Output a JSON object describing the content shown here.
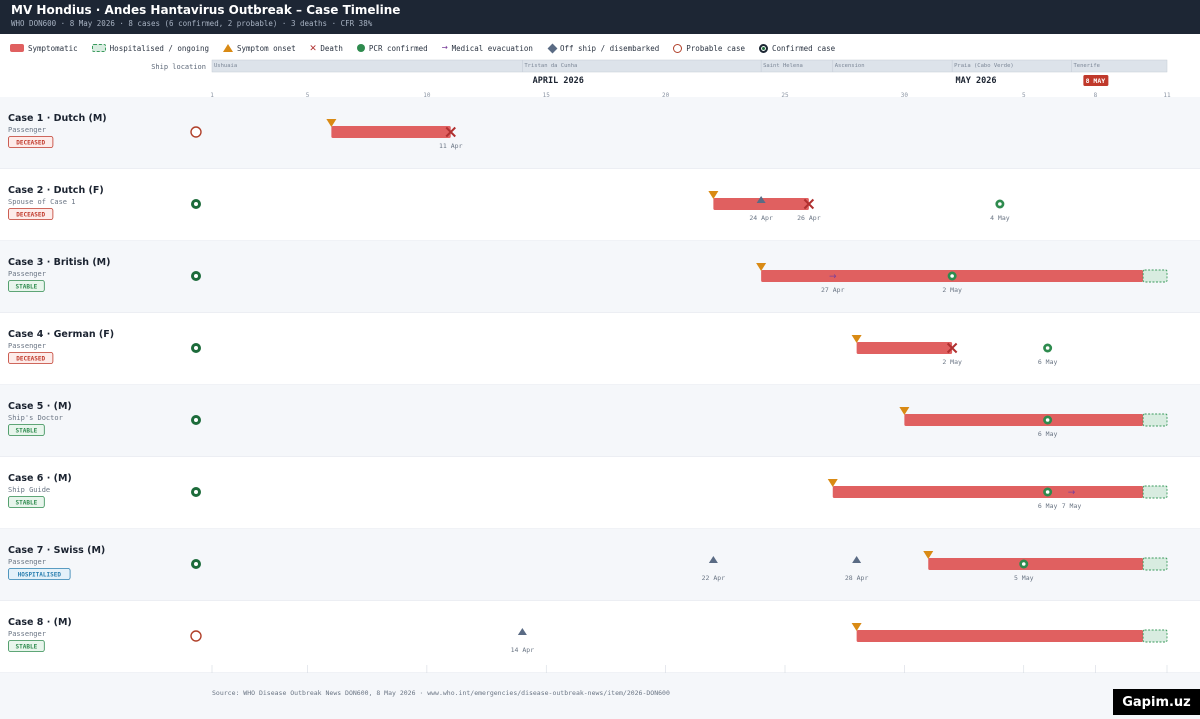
{
  "header": {
    "title": "MV Hondius · Andes Hantavirus Outbreak – Case Timeline",
    "subtitle": "WHO DON600 · 8 May 2026 · 8 cases (6 confirmed, 2 probable) · 3 deaths · CFR 38%"
  },
  "legend": {
    "items": [
      {
        "key": "symptomatic",
        "label": "Symptomatic",
        "icon": "bar-swatch"
      },
      {
        "key": "hospitalised",
        "label": "Hospitalised / ongoing",
        "icon": "dashed-bar-swatch"
      },
      {
        "key": "onset",
        "label": "Symptom onset",
        "icon": "triangle-icon"
      },
      {
        "key": "death",
        "label": "Death",
        "icon": "x-mark-icon"
      },
      {
        "key": "pcr",
        "label": "PCR confirmed",
        "icon": "dot-icon"
      },
      {
        "key": "medevac",
        "label": "Medical evacuation",
        "icon": "arrow-right-icon"
      },
      {
        "key": "offship",
        "label": "Off ship / disembarked",
        "icon": "diamond-icon"
      },
      {
        "key": "probable",
        "label": "Probable case",
        "icon": "hollow-circle-icon"
      },
      {
        "key": "confirmed",
        "label": "Confirmed case",
        "icon": "ringed-dot-icon"
      }
    ]
  },
  "colors": {
    "symptomatic": "#e06060",
    "hospital_fill": "#d8ece0",
    "hospital_border": "#3a9a5c",
    "onset": "#d98a14",
    "death": "#b03030",
    "pcr": "#2e8b4e",
    "medevac": "#7a3f9a",
    "offship": "#5a6b84",
    "probable": "#b0402a",
    "confirmed": "#1c6b3a",
    "today": "#c0392b",
    "deceased": "#c0392b",
    "stable": "#2e8b4e",
    "hospitalised_badge": "#2a7fb0"
  },
  "chart_data": {
    "type": "timeline",
    "ship_location_label": "Ship location",
    "x_range": [
      "2026-04-01",
      "2026-05-11"
    ],
    "months": [
      {
        "label": "APRIL 2026",
        "date": "2026-04-15"
      },
      {
        "label": "MAY 2026",
        "date": "2026-05-03"
      }
    ],
    "ticks": [
      {
        "label": "1",
        "date": "2026-04-01"
      },
      {
        "label": "5",
        "date": "2026-04-05"
      },
      {
        "label": "10",
        "date": "2026-04-10"
      },
      {
        "label": "15",
        "date": "2026-04-15"
      },
      {
        "label": "20",
        "date": "2026-04-20"
      },
      {
        "label": "25",
        "date": "2026-04-25"
      },
      {
        "label": "30",
        "date": "2026-04-30"
      },
      {
        "label": "5",
        "date": "2026-05-05"
      },
      {
        "label": "8",
        "date": "2026-05-08"
      },
      {
        "label": "11",
        "date": "2026-05-11"
      }
    ],
    "today": {
      "label": "8 MAY",
      "date": "2026-05-08"
    },
    "locations": [
      {
        "label": "Ushuaia",
        "start": "2026-04-01",
        "end": "2026-04-14"
      },
      {
        "label": "Tristan da Cunha",
        "start": "2026-04-14",
        "end": "2026-04-24"
      },
      {
        "label": "Saint Helena",
        "start": "2026-04-24",
        "end": "2026-04-27"
      },
      {
        "label": "Ascension",
        "start": "2026-04-27",
        "end": "2026-05-02"
      },
      {
        "label": "Praia (Cabo Verde)",
        "start": "2026-05-02",
        "end": "2026-05-07"
      },
      {
        "label": "Tenerife",
        "start": "2026-05-07",
        "end": "2026-05-11"
      }
    ],
    "cases": [
      {
        "title": "Case 1 · Dutch (M)",
        "role": "Passenger",
        "status": "DECEASED",
        "classification": "probable",
        "bars": [
          {
            "start": "2026-04-06",
            "end": "2026-04-11"
          }
        ],
        "hospital": null,
        "events": [
          {
            "type": "onset",
            "date": "2026-04-06"
          },
          {
            "type": "death",
            "date": "2026-04-11",
            "label": "11 Apr"
          }
        ]
      },
      {
        "title": "Case 2 · Dutch (F)",
        "role": "Spouse of Case 1",
        "status": "DECEASED",
        "classification": "confirmed",
        "bars": [
          {
            "start": "2026-04-22",
            "end": "2026-04-26"
          }
        ],
        "hospital": null,
        "events": [
          {
            "type": "onset",
            "date": "2026-04-22"
          },
          {
            "type": "offship",
            "date": "2026-04-24",
            "label": "24 Apr"
          },
          {
            "type": "death",
            "date": "2026-04-26",
            "label": "26 Apr"
          },
          {
            "type": "pcr",
            "date": "2026-05-04",
            "label": "4 May"
          }
        ]
      },
      {
        "title": "Case 3 · British (M)",
        "role": "Passenger",
        "status": "STABLE",
        "classification": "confirmed",
        "bars": [
          {
            "start": "2026-04-24",
            "end": "2026-05-10"
          }
        ],
        "hospital": {
          "start": "2026-05-10",
          "end": "2026-05-11"
        },
        "events": [
          {
            "type": "onset",
            "date": "2026-04-24"
          },
          {
            "type": "medevac",
            "date": "2026-04-27",
            "label": "27 Apr"
          },
          {
            "type": "pcr",
            "date": "2026-05-02",
            "label": "2 May"
          }
        ]
      },
      {
        "title": "Case 4 · German (F)",
        "role": "Passenger",
        "status": "DECEASED",
        "classification": "confirmed",
        "bars": [
          {
            "start": "2026-04-28",
            "end": "2026-05-02"
          }
        ],
        "hospital": null,
        "events": [
          {
            "type": "onset",
            "date": "2026-04-28"
          },
          {
            "type": "death",
            "date": "2026-05-02",
            "label": "2 May"
          },
          {
            "type": "pcr",
            "date": "2026-05-06",
            "label": "6 May"
          }
        ]
      },
      {
        "title": "Case 5 · (M)",
        "role": "Ship's Doctor",
        "status": "STABLE",
        "classification": "confirmed",
        "bars": [
          {
            "start": "2026-04-30",
            "end": "2026-05-10"
          }
        ],
        "hospital": {
          "start": "2026-05-10",
          "end": "2026-05-11"
        },
        "events": [
          {
            "type": "onset",
            "date": "2026-04-30"
          },
          {
            "type": "medevac",
            "date": "2026-05-06"
          },
          {
            "type": "pcr",
            "date": "2026-05-06",
            "label": "6 May"
          }
        ]
      },
      {
        "title": "Case 6 · (M)",
        "role": "Ship Guide",
        "status": "STABLE",
        "classification": "confirmed",
        "bars": [
          {
            "start": "2026-04-27",
            "end": "2026-05-10"
          }
        ],
        "hospital": {
          "start": "2026-05-10",
          "end": "2026-05-11"
        },
        "events": [
          {
            "type": "onset",
            "date": "2026-04-27"
          },
          {
            "type": "pcr",
            "date": "2026-05-06",
            "label": "6 May"
          },
          {
            "type": "medevac",
            "date": "2026-05-07",
            "label": "7 May"
          }
        ]
      },
      {
        "title": "Case 7 · Swiss (M)",
        "role": "Passenger",
        "status": "HOSPITALISED",
        "classification": "confirmed",
        "bars": [
          {
            "start": "2026-05-01",
            "end": "2026-05-10"
          }
        ],
        "hospital": {
          "start": "2026-05-10",
          "end": "2026-05-11"
        },
        "events": [
          {
            "type": "offship",
            "date": "2026-04-22",
            "label": "22 Apr"
          },
          {
            "type": "offship",
            "date": "2026-04-28",
            "label": "28 Apr"
          },
          {
            "type": "onset",
            "date": "2026-05-01"
          },
          {
            "type": "pcr",
            "date": "2026-05-05",
            "label": "5 May"
          }
        ]
      },
      {
        "title": "Case 8 · (M)",
        "role": "Passenger",
        "status": "STABLE",
        "classification": "probable",
        "bars": [
          {
            "start": "2026-04-28",
            "end": "2026-05-10"
          }
        ],
        "hospital": {
          "start": "2026-05-10",
          "end": "2026-05-11"
        },
        "events": [
          {
            "type": "offship",
            "date": "2026-04-14",
            "label": "14 Apr"
          },
          {
            "type": "onset",
            "date": "2026-04-28"
          }
        ]
      }
    ]
  },
  "footer": {
    "source": "Source: WHO Disease Outbreak News DON600, 8 May 2026 · www.who.int/emergencies/disease-outbreak-news/item/2026-DON600"
  },
  "watermark": {
    "text": "Gapim.uz"
  }
}
